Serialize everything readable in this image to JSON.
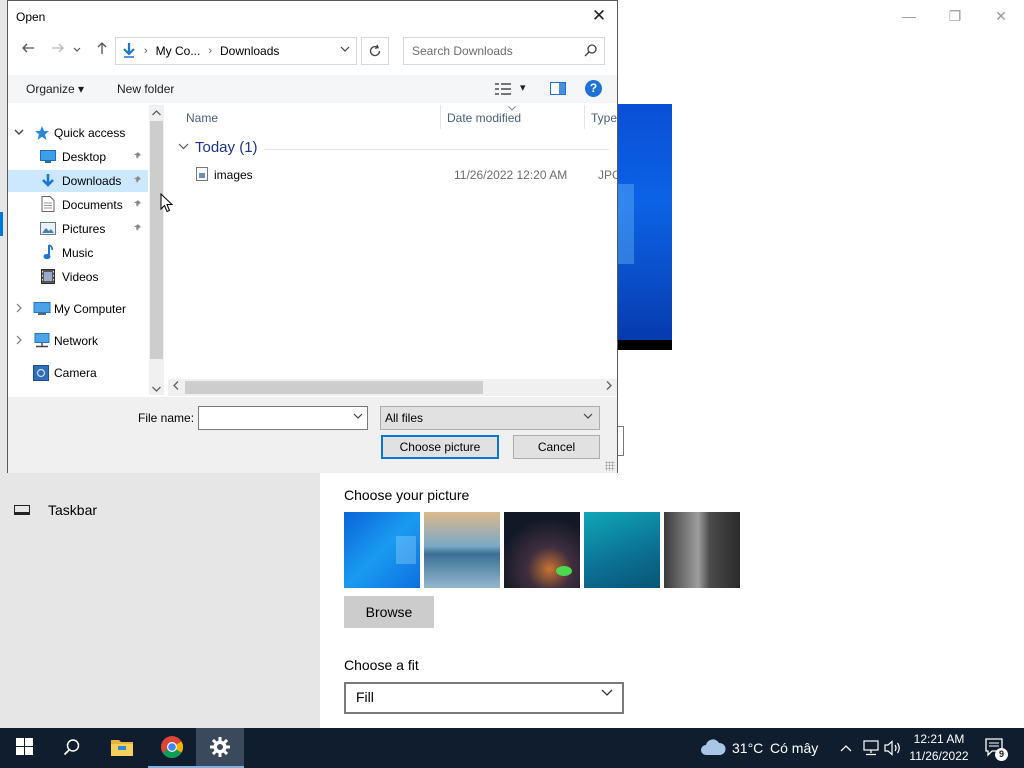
{
  "settings": {
    "taskbar_label": "Taskbar",
    "choose_picture_title": "Choose your picture",
    "browse_label": "Browse",
    "choose_fit_title": "Choose a fit",
    "fit_value": "Fill",
    "window_controls": {
      "minimize": "—",
      "maximize": "❐",
      "close": "✕"
    }
  },
  "dialog": {
    "title": "Open",
    "close_glyph": "✕",
    "address": {
      "crumbs": [
        "My Co...",
        "Downloads"
      ],
      "sep": "›"
    },
    "search_placeholder": "Search Downloads",
    "commands": {
      "organize": "Organize ▾",
      "new_folder": "New folder",
      "view_menu": "▾",
      "help": "?"
    },
    "nav": {
      "quick_access": "Quick access",
      "items": [
        {
          "label": "Desktop",
          "pinned": true
        },
        {
          "label": "Downloads",
          "pinned": true,
          "selected": true
        },
        {
          "label": "Documents",
          "pinned": true
        },
        {
          "label": "Pictures",
          "pinned": true
        },
        {
          "label": "Music"
        },
        {
          "label": "Videos"
        }
      ],
      "my_computer": "My Computer",
      "network": "Network",
      "camera": "Camera"
    },
    "columns": {
      "name": "Name",
      "date": "Date modified",
      "type": "Type"
    },
    "group": {
      "label": "Today (1)"
    },
    "files": [
      {
        "name": "images",
        "date": "11/26/2022 12:20 AM",
        "type": "JPG F"
      }
    ],
    "file_name_label": "File name:",
    "file_name_value": "",
    "filter_value": "All files",
    "choose_button": "Choose picture",
    "cancel_button": "Cancel"
  },
  "taskbar": {
    "weather_temp": "31°C",
    "weather_desc": "Có mây",
    "time": "12:21 AM",
    "date": "11/26/2022",
    "notification_count": "9"
  },
  "colors": {
    "accent": "#0078d7",
    "taskbar": "#0f1d2e",
    "selection": "#cce8ff"
  }
}
